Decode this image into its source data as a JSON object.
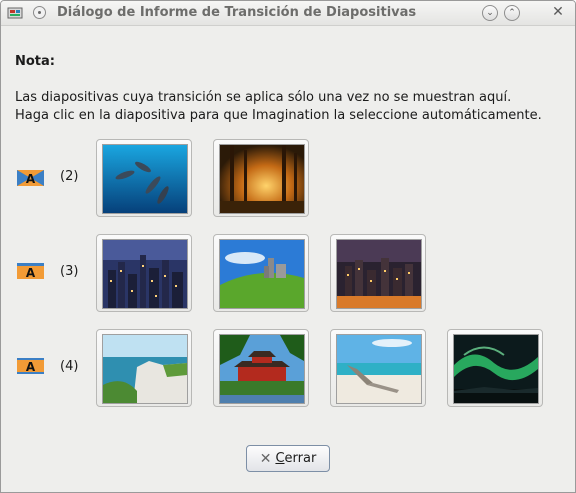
{
  "window": {
    "title": "Diálogo de Informe de Transición de Diapositivas"
  },
  "note": {
    "title": "Nota:",
    "line1": "Las diapositivas cuya transición se aplica sólo una vez no se muestran aquí.",
    "line2": "Haga clic en la diapositiva para que Imagination la seleccione automáticamente."
  },
  "groups": [
    {
      "count": "(2)",
      "icon": "transition-a-icon",
      "slides": [
        "dolphins",
        "forest-sunset"
      ]
    },
    {
      "count": "(3)",
      "icon": "transition-a-icon",
      "slides": [
        "city-night",
        "castle-hill",
        "city-lights"
      ]
    },
    {
      "count": "(4)",
      "icon": "transition-a-icon",
      "slides": [
        "cliffs-coast",
        "temple",
        "beach",
        "aurora"
      ]
    }
  ],
  "buttons": {
    "close_mnemonic": "C",
    "close_rest": "errar"
  },
  "colors": {
    "accent": "#7d8fa6",
    "icon_orange": "#f29b36",
    "icon_blue": "#3b7fc5"
  }
}
